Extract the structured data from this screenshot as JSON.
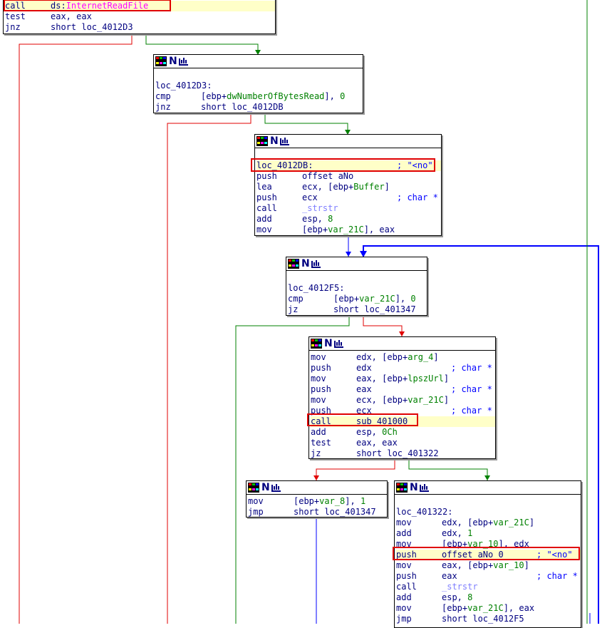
{
  "nodes": {
    "n0": {
      "lines": [
        {
          "mn": "call",
          "parts": [
            [
              "op",
              "ds:"
            ],
            [
              "api",
              "InternetReadFile"
            ]
          ]
        },
        {
          "mn": "test",
          "parts": [
            [
              "op",
              "eax, eax"
            ]
          ]
        },
        {
          "mn": "jnz",
          "parts": [
            [
              "op",
              "short loc_4012D3"
            ]
          ]
        }
      ]
    },
    "n1": {
      "lines": [
        {
          "label": ""
        },
        {
          "label": "loc_4012D3:"
        },
        {
          "mn": "cmp",
          "parts": [
            [
              "op",
              "[ebp+"
            ],
            [
              "var",
              "dwNumberOfBytesRead"
            ],
            [
              "op",
              "], "
            ],
            [
              "num",
              "0"
            ]
          ]
        },
        {
          "mn": "jnz",
          "parts": [
            [
              "op",
              "short loc_4012DB"
            ]
          ]
        }
      ]
    },
    "n2": {
      "lines": [
        {
          "label": ""
        },
        {
          "label": "loc_4012DB:",
          "cmt": "; \"<no\""
        },
        {
          "mn": "push",
          "parts": [
            [
              "op",
              "offset aNo"
            ]
          ]
        },
        {
          "mn": "lea",
          "parts": [
            [
              "op",
              "ecx, [ebp+"
            ],
            [
              "var",
              "Buffer"
            ],
            [
              "op",
              "]"
            ]
          ]
        },
        {
          "mn": "push",
          "parts": [
            [
              "op",
              "ecx"
            ]
          ],
          "cmt": "; char *"
        },
        {
          "mn": "call",
          "parts": [
            [
              "sub",
              "_strstr"
            ]
          ]
        },
        {
          "mn": "add",
          "parts": [
            [
              "op",
              "esp, "
            ],
            [
              "num",
              "8"
            ]
          ]
        },
        {
          "mn": "mov",
          "parts": [
            [
              "op",
              "[ebp+"
            ],
            [
              "var",
              "var_21C"
            ],
            [
              "op",
              "], eax"
            ]
          ]
        }
      ]
    },
    "n3": {
      "lines": [
        {
          "label": ""
        },
        {
          "label": "loc_4012F5:"
        },
        {
          "mn": "cmp",
          "parts": [
            [
              "op",
              "[ebp+"
            ],
            [
              "var",
              "var_21C"
            ],
            [
              "op",
              "], "
            ],
            [
              "num",
              "0"
            ]
          ]
        },
        {
          "mn": "jz",
          "parts": [
            [
              "op",
              "short loc_401347"
            ]
          ]
        }
      ]
    },
    "n4": {
      "lines": [
        {
          "mn": "mov",
          "parts": [
            [
              "op",
              "edx, [ebp+"
            ],
            [
              "var",
              "arg_4"
            ],
            [
              "op",
              "]"
            ]
          ]
        },
        {
          "mn": "push",
          "parts": [
            [
              "op",
              "edx"
            ]
          ],
          "cmt": "; char *"
        },
        {
          "mn": "mov",
          "parts": [
            [
              "op",
              "eax, [ebp+"
            ],
            [
              "var",
              "lpszUrl"
            ],
            [
              "op",
              "]"
            ]
          ]
        },
        {
          "mn": "push",
          "parts": [
            [
              "op",
              "eax"
            ]
          ],
          "cmt": "; char *"
        },
        {
          "mn": "mov",
          "parts": [
            [
              "op",
              "ecx, [ebp+"
            ],
            [
              "var",
              "var_21C"
            ],
            [
              "op",
              "]"
            ]
          ]
        },
        {
          "mn": "push",
          "parts": [
            [
              "op",
              "ecx"
            ]
          ],
          "cmt": "; char *"
        },
        {
          "mn": "call",
          "parts": [
            [
              "op",
              "sub_401000"
            ]
          ]
        },
        {
          "mn": "add",
          "parts": [
            [
              "op",
              "esp, "
            ],
            [
              "num",
              "0Ch"
            ]
          ]
        },
        {
          "mn": "test",
          "parts": [
            [
              "op",
              "eax, eax"
            ]
          ]
        },
        {
          "mn": "jz",
          "parts": [
            [
              "op",
              "short loc_401322"
            ]
          ]
        }
      ]
    },
    "n5": {
      "lines": [
        {
          "mn": "mov",
          "parts": [
            [
              "op",
              "[ebp+"
            ],
            [
              "var",
              "var_8"
            ],
            [
              "op",
              "], "
            ],
            [
              "num",
              "1"
            ]
          ]
        },
        {
          "mn": "jmp",
          "parts": [
            [
              "op",
              "short loc_401347"
            ]
          ]
        }
      ]
    },
    "n6": {
      "lines": [
        {
          "label": ""
        },
        {
          "label": "loc_401322:"
        },
        {
          "mn": "mov",
          "parts": [
            [
              "op",
              "edx, [ebp+"
            ],
            [
              "var",
              "var_21C"
            ],
            [
              "op",
              "]"
            ]
          ]
        },
        {
          "mn": "add",
          "parts": [
            [
              "op",
              "edx, "
            ],
            [
              "num",
              "1"
            ]
          ]
        },
        {
          "mn": "mov",
          "parts": [
            [
              "op",
              "[ebp+"
            ],
            [
              "var",
              "var_10"
            ],
            [
              "op",
              "], edx"
            ]
          ]
        },
        {
          "mn": "push",
          "parts": [
            [
              "op",
              "offset aNo_0"
            ]
          ],
          "cmt": "; \"<no\""
        },
        {
          "mn": "mov",
          "parts": [
            [
              "op",
              "eax, [ebp+"
            ],
            [
              "var",
              "var_10"
            ],
            [
              "op",
              "]"
            ]
          ]
        },
        {
          "mn": "push",
          "parts": [
            [
              "op",
              "eax"
            ]
          ],
          "cmt": "; char *"
        },
        {
          "mn": "call",
          "parts": [
            [
              "sub",
              "_strstr"
            ]
          ]
        },
        {
          "mn": "add",
          "parts": [
            [
              "op",
              "esp, "
            ],
            [
              "num",
              "8"
            ]
          ]
        },
        {
          "mn": "mov",
          "parts": [
            [
              "op",
              "[ebp+"
            ],
            [
              "var",
              "var_21C"
            ],
            [
              "op",
              "], eax"
            ]
          ]
        },
        {
          "mn": "jmp",
          "parts": [
            [
              "op",
              "short loc_4012F5"
            ]
          ]
        }
      ]
    }
  },
  "colors": {
    "edge_true": "#008000",
    "edge_false": "#e00000",
    "edge_uncond": "#0000ff",
    "highlight_border": "#e00000",
    "highlight_fill": "#ffffc8"
  }
}
